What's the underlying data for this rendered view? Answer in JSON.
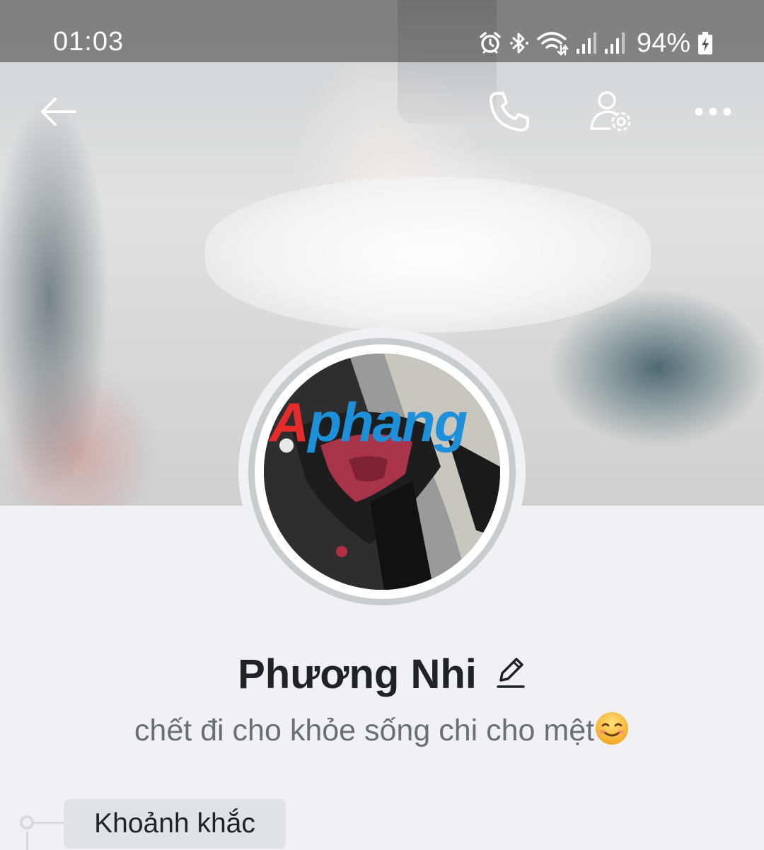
{
  "status_bar": {
    "time": "01:03",
    "battery_percent": "94%",
    "icons": [
      "alarm-icon",
      "bluetooth-icon",
      "wifi-icon",
      "signal-icon",
      "signal-icon",
      "battery-charging-icon"
    ]
  },
  "header": {
    "back_icon": "arrow-left-icon",
    "call_icon": "phone-icon",
    "settings_icon": "user-settings-icon",
    "more_icon": "more-horizontal-icon"
  },
  "avatar": {
    "watermark_text_first": "A",
    "watermark_text_rest": "phang"
  },
  "profile": {
    "name": "Phương Nhi",
    "edit_icon": "pencil-icon",
    "bio": "chết đi cho khỏe sống chi cho mệt",
    "bio_emoji": "smiling-face-icon"
  },
  "tabs": {
    "moments_label": "Khoảnh khắc"
  },
  "colors": {
    "background": "#f0f1f5",
    "name_text": "#1f2329",
    "bio_text": "#6a6f75",
    "tab_background": "#dfe2e7"
  }
}
